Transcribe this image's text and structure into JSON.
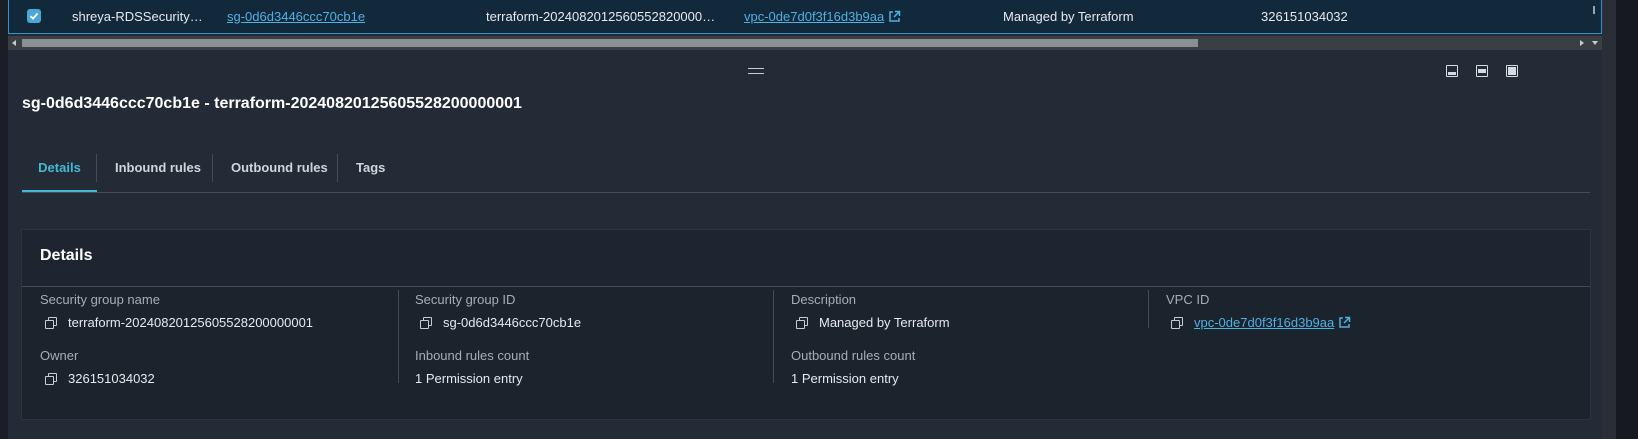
{
  "row": {
    "checked": true,
    "name": "shreya-RDSSecurity…",
    "group_id": "sg-0d6d3446ccc70cb1e",
    "group_name": "terraform-2024082012560552820000…",
    "vpc_id": "vpc-0de7d0f3f16d3b9aa",
    "description": "Managed by Terraform",
    "owner": "326151034032"
  },
  "panel": {
    "title": "sg-0d6d3446ccc70cb1e - terraform-20240820125605528200000001"
  },
  "tabs": [
    {
      "label": "Details",
      "active": true
    },
    {
      "label": "Inbound rules",
      "active": false
    },
    {
      "label": "Outbound rules",
      "active": false
    },
    {
      "label": "Tags",
      "active": false
    }
  ],
  "details": {
    "title": "Details",
    "security_group_name": {
      "label": "Security group name",
      "value": "terraform-20240820125605528200000001"
    },
    "security_group_id": {
      "label": "Security group ID",
      "value": "sg-0d6d3446ccc70cb1e"
    },
    "description": {
      "label": "Description",
      "value": "Managed by Terraform"
    },
    "vpc_id": {
      "label": "VPC ID",
      "value": "vpc-0de7d0f3f16d3b9aa"
    },
    "owner": {
      "label": "Owner",
      "value": "326151034032"
    },
    "inbound_rules_count": {
      "label": "Inbound rules count",
      "value": "1 Permission entry"
    },
    "outbound_rules_count": {
      "label": "Outbound rules count",
      "value": "1 Permission entry"
    }
  },
  "icons": {
    "checkbox": "checkmark-icon",
    "external_link": "external-link-icon",
    "copy": "copy-icon",
    "drag": "drag-handle-icon",
    "split": [
      "split-bottom-icon",
      "split-side-icon",
      "maximize-icon"
    ]
  },
  "colors": {
    "accent": "#44b9d6",
    "link": "#4fb0e2",
    "background": "#232b37",
    "card": "#1b232d"
  }
}
